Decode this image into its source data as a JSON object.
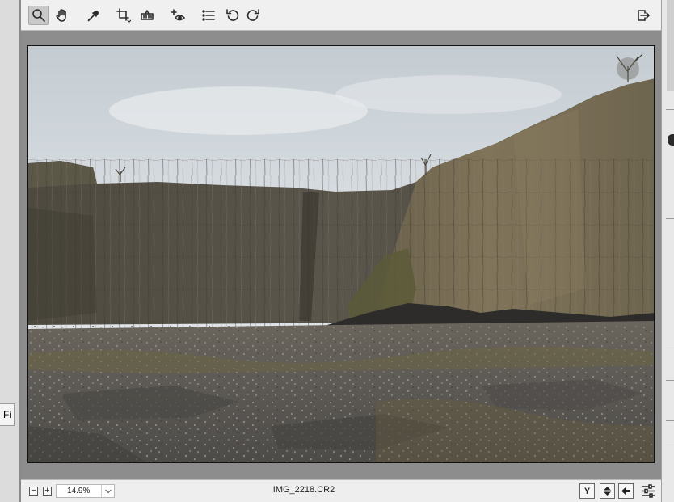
{
  "window": {
    "left_fragment_text": "Fi"
  },
  "toolbar": {
    "tools": [
      {
        "name": "zoom-tool",
        "icon": "magnifier-icon",
        "active": true
      },
      {
        "name": "hand-tool",
        "icon": "hand-icon",
        "active": false
      },
      {
        "name": "white-balance-tool",
        "icon": "eyedropper-icon",
        "active": false
      },
      {
        "name": "crop-tool",
        "icon": "crop-icon",
        "active": false
      },
      {
        "name": "straighten-tool",
        "icon": "level-icon",
        "active": false
      },
      {
        "name": "red-eye-tool",
        "icon": "plus-eye-icon",
        "active": false
      },
      {
        "name": "presets-list",
        "icon": "list-icon",
        "active": false
      },
      {
        "name": "rotate-left",
        "icon": "rotate-ccw-icon",
        "active": false
      },
      {
        "name": "rotate-right",
        "icon": "rotate-cw-icon",
        "active": false
      },
      {
        "name": "full-screen",
        "icon": "exit-arrow-icon",
        "active": false
      }
    ]
  },
  "status": {
    "zoom_minus": "−",
    "zoom_plus": "+",
    "zoom_value": "14.9%",
    "filename": "IMG_2218.CR2",
    "before_after_label": "Y",
    "colors": {
      "accent": "#8d8d8d",
      "toolbar_bg": "#f0f0f0"
    }
  }
}
